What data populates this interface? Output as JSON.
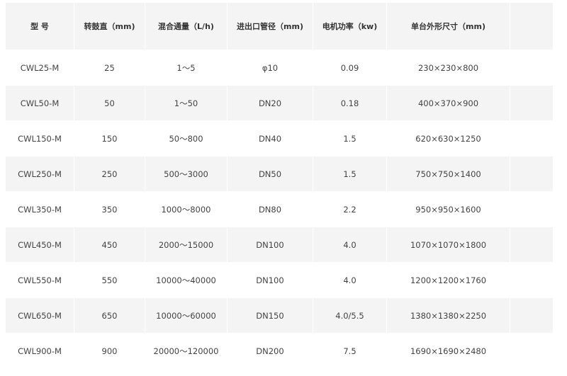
{
  "table": {
    "headers": [
      "型 号",
      "转鼓直（mm)",
      "混合通量（L/h)",
      "进出口管径（mm)",
      "电机功率（kw)",
      "单台外形尺寸（mm)",
      ""
    ],
    "rows": [
      [
        "CWL25-M",
        "25",
        "1～5",
        "φ10",
        "0.09",
        "230×230×800",
        ""
      ],
      [
        "CWL50-M",
        "50",
        "1～50",
        "DN20",
        "0.18",
        "400×370×900",
        ""
      ],
      [
        "CWL150-M",
        "150",
        "50～800",
        "DN40",
        "1.5",
        "620×630×1250",
        ""
      ],
      [
        "CWL250-M",
        "250",
        "500～3000",
        "DN50",
        "1.5",
        "750×750×1400",
        ""
      ],
      [
        "CWL350-M",
        "350",
        "1000～8000",
        "DN80",
        "2.2",
        "950×950×1600",
        ""
      ],
      [
        "CWL450-M",
        "450",
        "2000～15000",
        "DN100",
        "4.0",
        "1070×1070×1800",
        ""
      ],
      [
        "CWL550-M",
        "550",
        "10000～40000",
        "DN100",
        "4.0",
        "1200×1200×1760",
        ""
      ],
      [
        "CWL650-M",
        "650",
        "10000～60000",
        "DN150",
        "4.0/5.5",
        "1380×1380×2250",
        ""
      ],
      [
        "CWL900-M",
        "900",
        "20000～120000",
        "DN200",
        "7.5",
        "1690×1690×2480",
        ""
      ]
    ]
  }
}
